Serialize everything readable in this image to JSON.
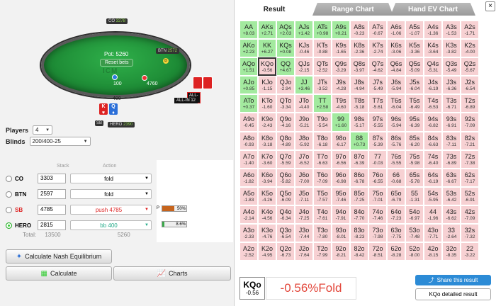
{
  "table": {
    "pot_label": "Pot: 5260",
    "reset_label": "Reset bets",
    "logo_text": "ICM",
    "seat_co": {
      "name": "CO",
      "stack": "3278"
    },
    "seat_btn": {
      "name": "BTN",
      "stack": "2572"
    },
    "seat_hero": {
      "name": "HERO",
      "stack": "2390"
    },
    "seat_sb": {
      "name": "SB"
    },
    "bet_100": "100",
    "bet_4760": "4760",
    "bet_400": "400",
    "allin_text": "ALL-IN",
    "allin_text2": "ALL-IN 12",
    "hero_cards": [
      "K",
      "Q"
    ]
  },
  "controls": {
    "players_label": "Players",
    "players_value": "4",
    "blinds_label": "Blinds",
    "blinds_value": "200/400-25",
    "stack_header": "Stack",
    "action_header": "Action"
  },
  "players": [
    {
      "name": "CO",
      "stack": "3303",
      "action": "fold",
      "selected": false,
      "style": ""
    },
    {
      "name": "BTN",
      "stack": "2597",
      "action": "fold",
      "selected": false,
      "style": ""
    },
    {
      "name": "SB",
      "stack": "4785",
      "action": "push 4785",
      "selected": false,
      "style": "red"
    },
    {
      "name": "HERO",
      "stack": "2815",
      "action": "bb 400",
      "selected": true,
      "style": "green"
    }
  ],
  "equity": {
    "sb": {
      "label": "P",
      "value": "50%",
      "fraction": 0.5,
      "color": "#c6641d"
    },
    "hero": {
      "value": "8.6%",
      "fraction": 0.086,
      "color": "#3aa84a"
    }
  },
  "totals": {
    "label": "Total:",
    "stack_total": "13500",
    "pot_total": "5260"
  },
  "buttons": {
    "nash": "Calculate Nash Equilibrium",
    "calculate": "Calculate",
    "charts": "Charts"
  },
  "tabs": {
    "result": "Result",
    "range_chart": "Range Chart",
    "hand_ev_chart": "Hand EV Chart",
    "close": "×"
  },
  "grid": [
    [
      [
        "AA",
        "+8.03"
      ],
      [
        "AKs",
        "+2.71"
      ],
      [
        "AQs",
        "+2.03"
      ],
      [
        "AJs",
        "+1.42"
      ],
      [
        "ATs",
        "+0.98"
      ],
      [
        "A9s",
        "+0.21"
      ],
      [
        "A8s",
        "-0.23"
      ],
      [
        "A7s",
        "-0.67"
      ],
      [
        "A6s",
        "-1.06"
      ],
      [
        "A5s",
        "-1.07"
      ],
      [
        "A4s",
        "-1.36"
      ],
      [
        "A3s",
        "-1.53"
      ],
      [
        "A2s",
        "-1.71"
      ]
    ],
    [
      [
        "AKo",
        "+2.23"
      ],
      [
        "KK",
        "+6.27"
      ],
      [
        "KQs",
        "+0.08"
      ],
      [
        "KJs",
        "-0.46"
      ],
      [
        "KTs",
        "-0.88"
      ],
      [
        "K9s",
        "-1.65"
      ],
      [
        "K8s",
        "-2.36"
      ],
      [
        "K7s",
        "-2.74"
      ],
      [
        "K6s",
        "-3.06"
      ],
      [
        "K5s",
        "-3.36"
      ],
      [
        "K4s",
        "-3.64"
      ],
      [
        "K3s",
        "-3.82"
      ],
      [
        "K2s",
        "-4.00"
      ]
    ],
    [
      [
        "AQo",
        "+1.51"
      ],
      [
        "KQo",
        "-0.56"
      ],
      [
        "QQ",
        "+4.67"
      ],
      [
        "QJs",
        "-2.15"
      ],
      [
        "QTs",
        "-2.52"
      ],
      [
        "Q9s",
        "-3.29"
      ],
      [
        "Q8s",
        "-3.97"
      ],
      [
        "Q7s",
        "-4.62"
      ],
      [
        "Q6s",
        "-4.84"
      ],
      [
        "Q5s",
        "-5.09"
      ],
      [
        "Q4s",
        "-5.31"
      ],
      [
        "Q3s",
        "-5.49"
      ],
      [
        "Q2s",
        "-5.67"
      ]
    ],
    [
      [
        "AJo",
        "+0.85"
      ],
      [
        "KJo",
        "-1.15"
      ],
      [
        "QJo",
        "-2.94"
      ],
      [
        "JJ",
        "+3.46"
      ],
      [
        "JTs",
        "-3.52"
      ],
      [
        "J9s",
        "-4.28"
      ],
      [
        "J8s",
        "-4.94"
      ],
      [
        "J7s",
        "-5.49"
      ],
      [
        "J6s",
        "-5.94"
      ],
      [
        "J5s",
        "-6.04"
      ],
      [
        "J4s",
        "-6.19"
      ],
      [
        "J3s",
        "-6.36"
      ],
      [
        "J2s",
        "-6.54"
      ]
    ],
    [
      [
        "ATo",
        "+0.37"
      ],
      [
        "KTo",
        "-1.60"
      ],
      [
        "QTo",
        "-3.34"
      ],
      [
        "JTo",
        "-4.40"
      ],
      [
        "TT",
        "+2.58"
      ],
      [
        "T9s",
        "-4.60"
      ],
      [
        "T8s",
        "-5.18"
      ],
      [
        "T7s",
        "-5.61"
      ],
      [
        "T6s",
        "-6.04"
      ],
      [
        "T5s",
        "-6.49"
      ],
      [
        "T4s",
        "-6.53"
      ],
      [
        "T3s",
        "-6.71"
      ],
      [
        "T2s",
        "-6.89"
      ]
    ],
    [
      [
        "A9o",
        "-0.45"
      ],
      [
        "K9o",
        "-2.43"
      ],
      [
        "Q9o",
        "-4.16"
      ],
      [
        "J9o",
        "-5.21"
      ],
      [
        "T9o",
        "-5.54"
      ],
      [
        "99",
        "+1.60"
      ],
      [
        "98s",
        "-5.17"
      ],
      [
        "97s",
        "-5.55"
      ],
      [
        "96s",
        "-5.94"
      ],
      [
        "95s",
        "-6.39"
      ],
      [
        "94s",
        "-6.82"
      ],
      [
        "93s",
        "-6.91"
      ],
      [
        "92s",
        "-7.09"
      ]
    ],
    [
      [
        "A8o",
        "-0.93"
      ],
      [
        "K8o",
        "-3.18"
      ],
      [
        "Q8o",
        "-4.89"
      ],
      [
        "J8o",
        "-5.92"
      ],
      [
        "T8o",
        "-6.18"
      ],
      [
        "98o",
        "-6.17"
      ],
      [
        "88",
        "+0.73"
      ],
      [
        "87s",
        "-5.39"
      ],
      [
        "86s",
        "-5.76"
      ],
      [
        "85s",
        "-6.20"
      ],
      [
        "84s",
        "-6.63"
      ],
      [
        "83s",
        "-7.11"
      ],
      [
        "82s",
        "-7.21"
      ]
    ],
    [
      [
        "A7o",
        "-1.40"
      ],
      [
        "K7o",
        "-3.60"
      ],
      [
        "Q7o",
        "-5.59"
      ],
      [
        "J7o",
        "-6.52"
      ],
      [
        "T7o",
        "-6.63"
      ],
      [
        "97o",
        "-6.56"
      ],
      [
        "87o",
        "-6.39"
      ],
      [
        "77",
        "-0.03"
      ],
      [
        "76s",
        "-5.55"
      ],
      [
        "75s",
        "-5.98"
      ],
      [
        "74s",
        "-6.40"
      ],
      [
        "73s",
        "-6.89"
      ],
      [
        "72s",
        "-7.38"
      ]
    ],
    [
      [
        "A6o",
        "-1.82"
      ],
      [
        "K6o",
        "-3.94"
      ],
      [
        "Q6o",
        "-5.82"
      ],
      [
        "J6o",
        "-7.00"
      ],
      [
        "T6o",
        "-7.09"
      ],
      [
        "96o",
        "-6.98"
      ],
      [
        "86o",
        "-6.78"
      ],
      [
        "76o",
        "-6.55"
      ],
      [
        "66",
        "-0.68"
      ],
      [
        "65s",
        "-5.78"
      ],
      [
        "64s",
        "-6.19"
      ],
      [
        "63s",
        "-6.67"
      ],
      [
        "62s",
        "-7.17"
      ]
    ],
    [
      [
        "A5o",
        "-1.83"
      ],
      [
        "K5o",
        "-4.26"
      ],
      [
        "Q5o",
        "-6.09"
      ],
      [
        "J5o",
        "-7.11"
      ],
      [
        "T5o",
        "-7.57"
      ],
      [
        "95o",
        "-7.46"
      ],
      [
        "85o",
        "-7.25"
      ],
      [
        "75o",
        "-7.01"
      ],
      [
        "65o",
        "-6.79"
      ],
      [
        "55",
        "-1.31"
      ],
      [
        "54s",
        "-5.95"
      ],
      [
        "53s",
        "-6.42"
      ],
      [
        "52s",
        "-6.91"
      ]
    ],
    [
      [
        "A4o",
        "-2.14"
      ],
      [
        "K4o",
        "-4.56"
      ],
      [
        "Q4o",
        "-6.34"
      ],
      [
        "J4o",
        "-7.25"
      ],
      [
        "T4o",
        "-7.61"
      ],
      [
        "94o",
        "-7.91"
      ],
      [
        "84o",
        "-7.70"
      ],
      [
        "74o",
        "-7.46"
      ],
      [
        "64o",
        "-7.23"
      ],
      [
        "54o",
        "-6.97"
      ],
      [
        "44",
        "-1.96"
      ],
      [
        "43s",
        "-6.62"
      ],
      [
        "42s",
        "-7.09"
      ]
    ],
    [
      [
        "A3o",
        "-2.33"
      ],
      [
        "K3o",
        "-4.76"
      ],
      [
        "Q3o",
        "-6.54"
      ],
      [
        "J3o",
        "-7.44"
      ],
      [
        "T3o",
        "-7.80"
      ],
      [
        "93o",
        "-8.01"
      ],
      [
        "83o",
        "-8.23"
      ],
      [
        "73o",
        "-7.98"
      ],
      [
        "63o",
        "-7.75"
      ],
      [
        "53o",
        "-7.48"
      ],
      [
        "43o",
        "-7.71"
      ],
      [
        "33",
        "-2.64"
      ],
      [
        "32s",
        "-7.32"
      ]
    ],
    [
      [
        "A2o",
        "-2.52"
      ],
      [
        "K2o",
        "-4.95"
      ],
      [
        "Q2o",
        "-6.73"
      ],
      [
        "J2o",
        "-7.64"
      ],
      [
        "T2o",
        "-7.99"
      ],
      [
        "92o",
        "-8.21"
      ],
      [
        "82o",
        "-8.42"
      ],
      [
        "72o",
        "-8.51"
      ],
      [
        "62o",
        "-8.28"
      ],
      [
        "52o",
        "-8.00"
      ],
      [
        "42o",
        "-8.15"
      ],
      [
        "32o",
        "-8.35"
      ],
      [
        "22",
        "-3.22"
      ]
    ]
  ],
  "selected": {
    "hand": "KQo",
    "ev": "-0.56",
    "result": "-0.56%Fold"
  },
  "share_label": "Share this result",
  "detail_label": "KQo detailed result",
  "colors": {
    "push": "#a3ea9f",
    "fold": "#f7d1d3",
    "accent": "#2c8bd6",
    "fold_text": "#e2463a"
  }
}
